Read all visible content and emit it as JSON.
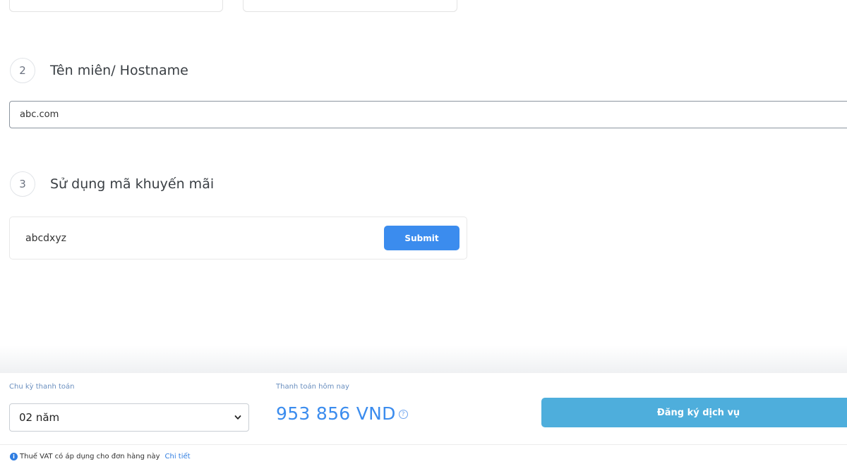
{
  "steps": [
    {
      "number": "2",
      "title": "Tên miên/ Hostname"
    },
    {
      "number": "3",
      "title": "Sử dụng mã khuyến mãi"
    }
  ],
  "hostname": {
    "value": "abc.com"
  },
  "promo": {
    "value": "abcdxyz",
    "submit_label": "Submit"
  },
  "footer": {
    "cycle_label": "Chu kỳ thanh toán",
    "cycle_value": "02 năm",
    "today_label": "Thanh toán hôm nay",
    "price": "953 856 VND",
    "help_icon": "?",
    "register_label": "Đăng ký dịch vụ",
    "vat_icon": "i",
    "vat_text": "Thuế VAT có áp dụng cho đơn hàng này",
    "vat_link": "Chi tiết"
  },
  "colors": {
    "accent": "#3b8cee",
    "register": "#4eaedc",
    "label": "#6a8fbf"
  }
}
